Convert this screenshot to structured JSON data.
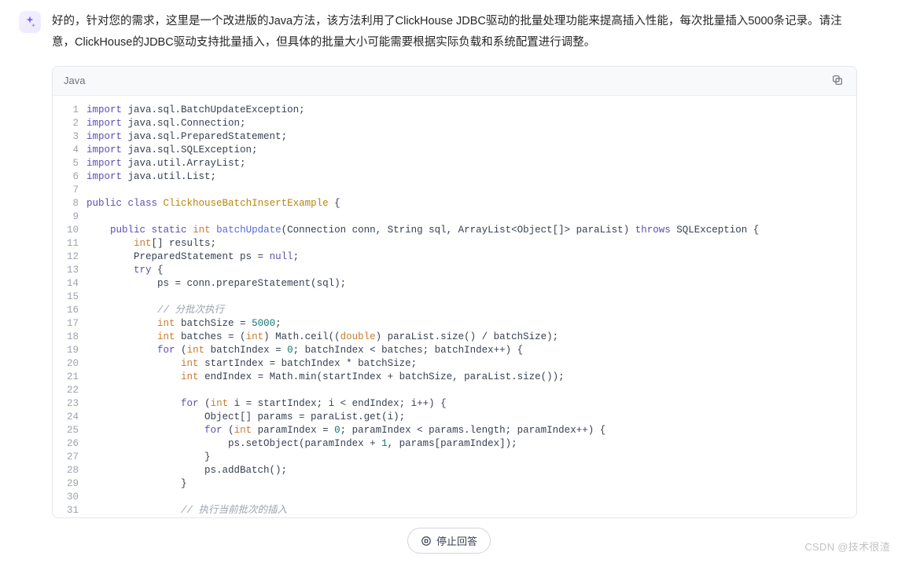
{
  "intro": "好的，针对您的需求，这里是一个改进版的Java方法，该方法利用了ClickHouse JDBC驱动的批量处理功能来提高插入性能，每次批量插入5000条记录。请注意，ClickHouse的JDBC驱动支持批量插入，但具体的批量大小可能需要根据实际负载和系统配置进行调整。",
  "avatar": {
    "name": "bot-avatar"
  },
  "code": {
    "language_label": "Java",
    "copy_tooltip": "Copy",
    "lines": [
      [
        [
          "kw",
          "import"
        ],
        [
          "id",
          " java.sql.BatchUpdateException;"
        ]
      ],
      [
        [
          "kw",
          "import"
        ],
        [
          "id",
          " java.sql.Connection;"
        ]
      ],
      [
        [
          "kw",
          "import"
        ],
        [
          "id",
          " java.sql.PreparedStatement;"
        ]
      ],
      [
        [
          "kw",
          "import"
        ],
        [
          "id",
          " java.sql.SQLException;"
        ]
      ],
      [
        [
          "kw",
          "import"
        ],
        [
          "id",
          " java.util.ArrayList;"
        ]
      ],
      [
        [
          "kw",
          "import"
        ],
        [
          "id",
          " java.util.List;"
        ]
      ],
      [],
      [
        [
          "kw",
          "public class "
        ],
        [
          "cl",
          "ClickhouseBatchInsertExample"
        ],
        [
          "id",
          " {"
        ]
      ],
      [],
      [
        [
          "id",
          "    "
        ],
        [
          "kw",
          "public static "
        ],
        [
          "ty",
          "int "
        ],
        [
          "fn",
          "batchUpdate"
        ],
        [
          "id",
          "("
        ],
        [
          "id",
          "Connection conn, String sql, ArrayList<Object[]> paraList"
        ],
        [
          "id",
          ") "
        ],
        [
          "kw",
          "throws"
        ],
        [
          "id",
          " SQLException {"
        ]
      ],
      [
        [
          "id",
          "        "
        ],
        [
          "ty",
          "int"
        ],
        [
          "id",
          "[] results;"
        ]
      ],
      [
        [
          "id",
          "        PreparedStatement ps = "
        ],
        [
          "kw",
          "null"
        ],
        [
          "id",
          ";"
        ]
      ],
      [
        [
          "id",
          "        "
        ],
        [
          "kw",
          "try"
        ],
        [
          "id",
          " {"
        ]
      ],
      [
        [
          "id",
          "            ps = conn.prepareStatement(sql);"
        ]
      ],
      [],
      [
        [
          "id",
          "            "
        ],
        [
          "cmt",
          "// 分批次执行"
        ]
      ],
      [
        [
          "id",
          "            "
        ],
        [
          "ty",
          "int"
        ],
        [
          "id",
          " batchSize = "
        ],
        [
          "num",
          "5000"
        ],
        [
          "id",
          ";"
        ]
      ],
      [
        [
          "id",
          "            "
        ],
        [
          "ty",
          "int"
        ],
        [
          "id",
          " batches = ("
        ],
        [
          "ty",
          "int"
        ],
        [
          "id",
          ") Math.ceil(("
        ],
        [
          "ty",
          "double"
        ],
        [
          "id",
          ") paraList.size() / batchSize);"
        ]
      ],
      [
        [
          "id",
          "            "
        ],
        [
          "kw",
          "for"
        ],
        [
          "id",
          " ("
        ],
        [
          "ty",
          "int"
        ],
        [
          "id",
          " batchIndex = "
        ],
        [
          "num",
          "0"
        ],
        [
          "id",
          "; batchIndex < batches; batchIndex++) {"
        ]
      ],
      [
        [
          "id",
          "                "
        ],
        [
          "ty",
          "int"
        ],
        [
          "id",
          " startIndex = batchIndex * batchSize;"
        ]
      ],
      [
        [
          "id",
          "                "
        ],
        [
          "ty",
          "int"
        ],
        [
          "id",
          " endIndex = Math.min(startIndex + batchSize, paraList.size());"
        ]
      ],
      [],
      [
        [
          "id",
          "                "
        ],
        [
          "kw",
          "for"
        ],
        [
          "id",
          " ("
        ],
        [
          "ty",
          "int"
        ],
        [
          "id",
          " i = startIndex; i < endIndex; i++) {"
        ]
      ],
      [
        [
          "id",
          "                    Object[] params = paraList.get(i);"
        ]
      ],
      [
        [
          "id",
          "                    "
        ],
        [
          "kw",
          "for"
        ],
        [
          "id",
          " ("
        ],
        [
          "ty",
          "int"
        ],
        [
          "id",
          " paramIndex = "
        ],
        [
          "num",
          "0"
        ],
        [
          "id",
          "; paramIndex < params.length; paramIndex++) {"
        ]
      ],
      [
        [
          "id",
          "                        ps.setObject(paramIndex + "
        ],
        [
          "num",
          "1"
        ],
        [
          "id",
          ", params[paramIndex]);"
        ]
      ],
      [
        [
          "id",
          "                    }"
        ]
      ],
      [
        [
          "id",
          "                    ps.addBatch();"
        ]
      ],
      [
        [
          "id",
          "                }"
        ]
      ],
      [],
      [
        [
          "id",
          "                "
        ],
        [
          "cmt",
          "// 执行当前批次的插入"
        ]
      ]
    ]
  },
  "stop_button": {
    "label": "停止回答"
  },
  "watermark": "CSDN @技术很渣"
}
